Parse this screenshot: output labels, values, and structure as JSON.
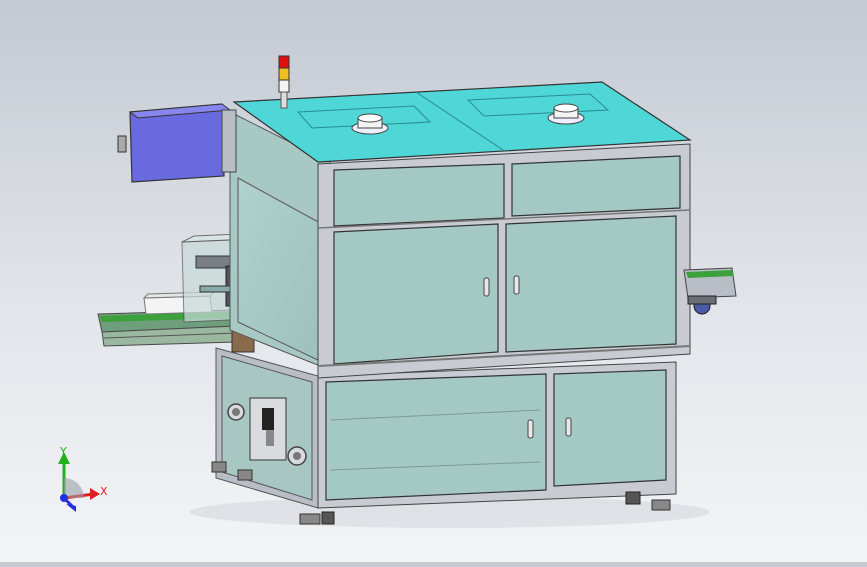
{
  "viewport": {
    "background_top": "#c4c9d2",
    "background_bottom": "#f3f4f6"
  },
  "model": {
    "top_panel_color": "#4fd6d6",
    "enclosure_panel_color": "#a4c8c4",
    "frame_color": "#c8ccd2",
    "control_box_color": "#6a6ae0",
    "signal_tower_colors": [
      "#e01010",
      "#f0c020",
      "#f4f4f4"
    ],
    "conveyor_belt_color": "#3ca03c"
  },
  "triad": {
    "x_label": "X",
    "y_label": "Y",
    "x_color": "#e02020",
    "y_color": "#20b020",
    "z_color": "#2030e0"
  }
}
